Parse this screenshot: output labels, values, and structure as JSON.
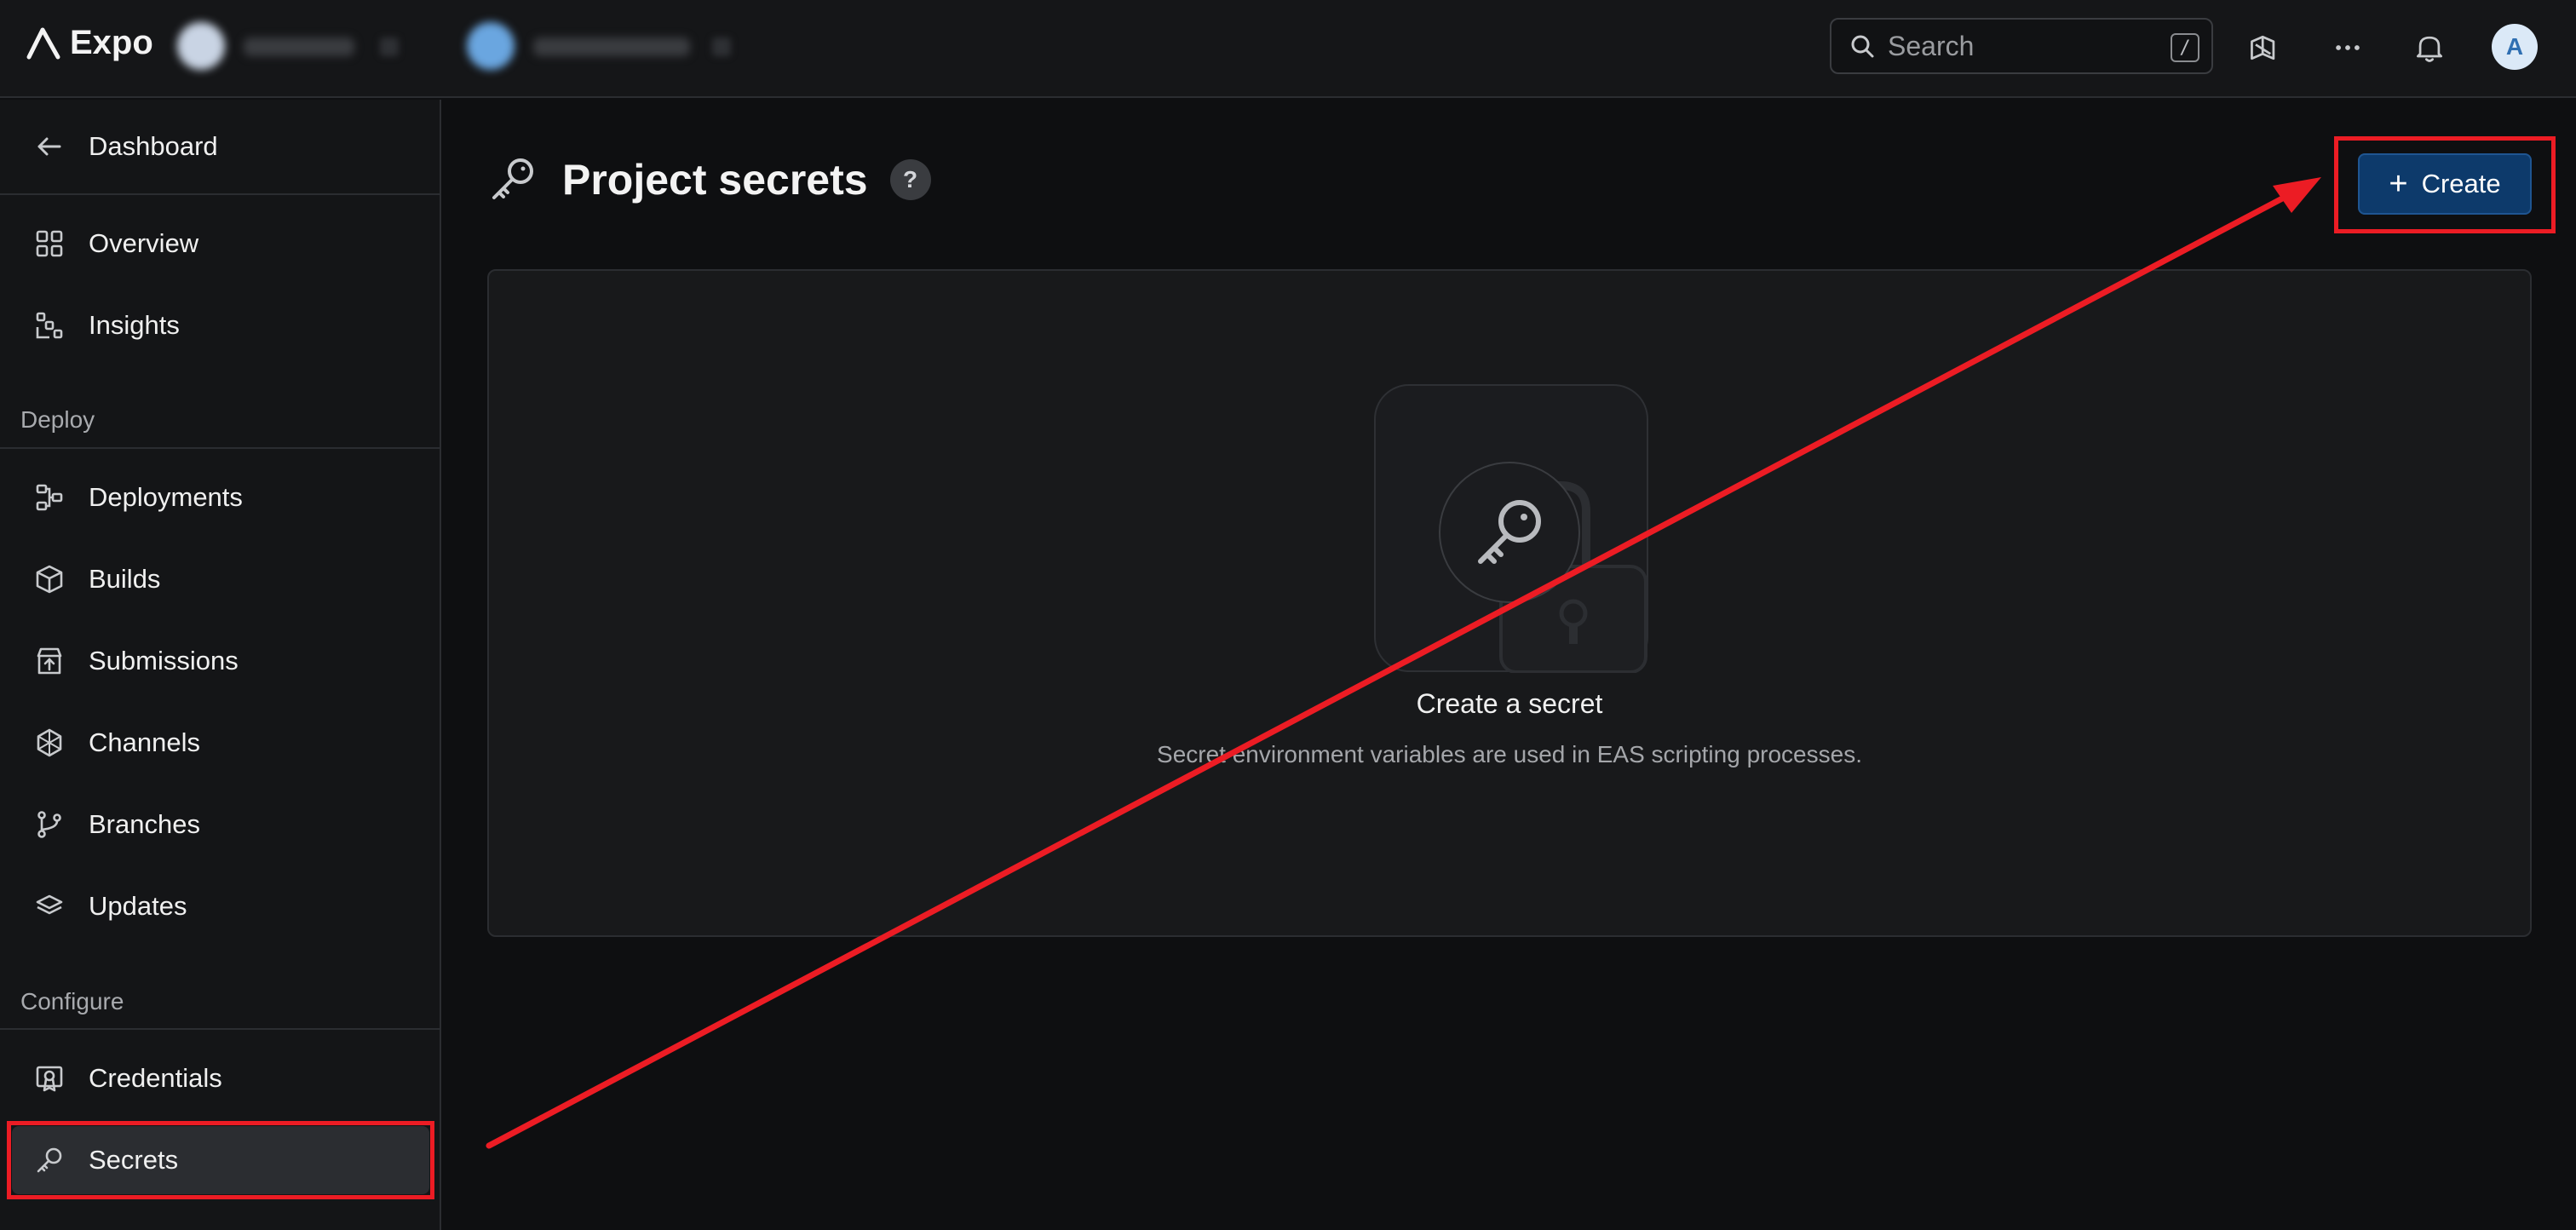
{
  "topbar": {
    "logo_text": "Expo",
    "search_placeholder": "Search",
    "search_shortcut": "/",
    "avatar_initial": "A"
  },
  "sidebar": {
    "back_label": "Dashboard",
    "items_top": [
      {
        "label": "Overview",
        "icon": "grid-icon"
      },
      {
        "label": "Insights",
        "icon": "insights-icon"
      }
    ],
    "section_deploy": "Deploy",
    "items_deploy": [
      {
        "label": "Deployments",
        "icon": "deployments-icon"
      },
      {
        "label": "Builds",
        "icon": "cube-icon"
      },
      {
        "label": "Submissions",
        "icon": "store-upload-icon"
      },
      {
        "label": "Channels",
        "icon": "channels-icon"
      },
      {
        "label": "Branches",
        "icon": "git-branch-icon"
      },
      {
        "label": "Updates",
        "icon": "layers-icon"
      }
    ],
    "section_configure": "Configure",
    "items_configure": [
      {
        "label": "Credentials",
        "icon": "certificate-icon"
      },
      {
        "label": "Secrets",
        "icon": "key-icon",
        "active": true
      }
    ]
  },
  "main": {
    "title": "Project secrets",
    "help": "?",
    "create_label": "Create",
    "empty_title": "Create a secret",
    "empty_desc": "Secret environment variables are used in EAS scripting processes."
  },
  "annotation_color": "#ec1c24",
  "accent_color": "#0d3a6b"
}
